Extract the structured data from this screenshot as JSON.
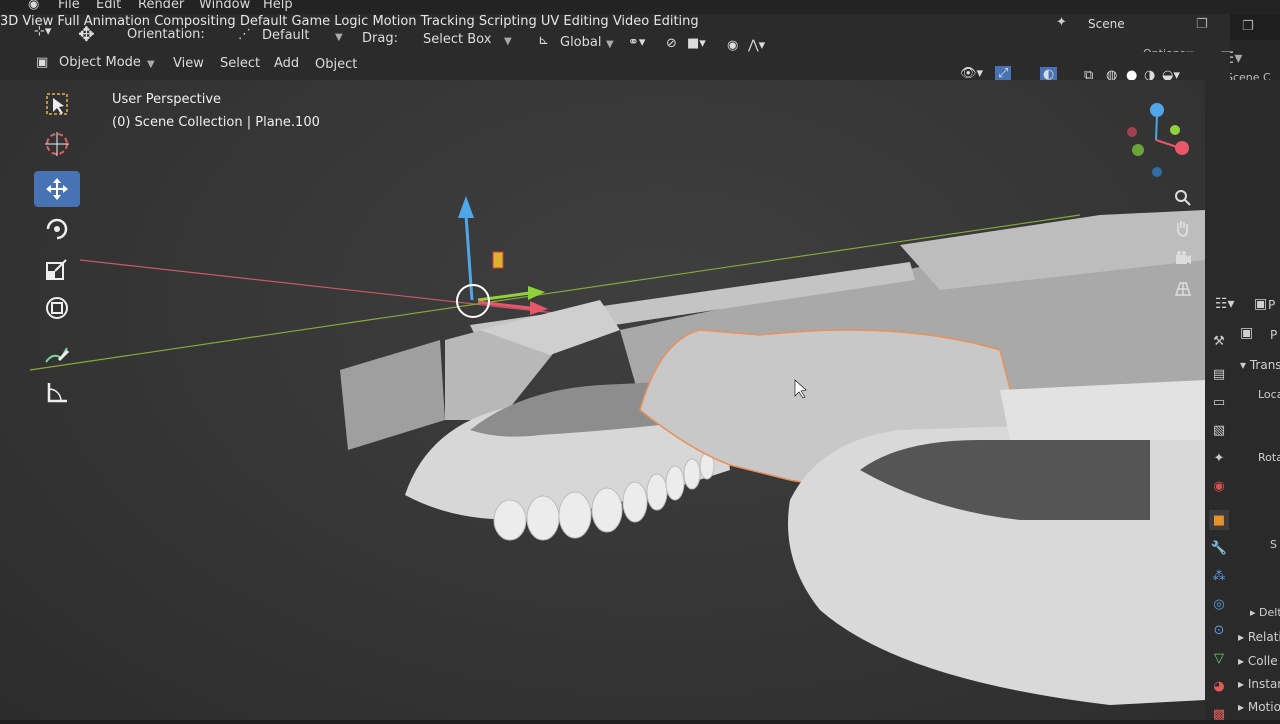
{
  "menu": {
    "file": "File",
    "edit": "Edit",
    "render": "Render",
    "window": "Window",
    "help": "Help"
  },
  "workspaces": [
    "3D View Full",
    "Animation",
    "Compositing",
    "Default",
    "Game Logic",
    "Motion Tracking",
    "Scripting",
    "UV Editing",
    "Video Editing"
  ],
  "scene_label": "Scene",
  "toolbar": {
    "orientation_label": "Orientation:",
    "orientation_value": "Default",
    "drag_label": "Drag:",
    "drag_value": "Select Box",
    "transform_orientation": "Global",
    "options_label": "Options"
  },
  "header": {
    "mode": "Object Mode",
    "view": "View",
    "select": "Select",
    "add": "Add",
    "object": "Object"
  },
  "viewport": {
    "perspective": "User Perspective",
    "collection": "(0) Scene Collection | Plane.100"
  },
  "outliner": {
    "header": "Scene C"
  },
  "properties": {
    "panel_label": "P",
    "transform": "Trans",
    "location": "Loca",
    "rotation": "Rota",
    "scale": "S",
    "delta": "Delt",
    "relations": "Relati",
    "collections": "Colle",
    "instancing": "Instan",
    "motion": "Motion"
  },
  "colors": {
    "accent": "#4772b3",
    "selection_outline": "#e8915a",
    "axis_x": "#e8566a",
    "axis_y": "#8fd13a",
    "axis_z": "#4fa7e8"
  }
}
